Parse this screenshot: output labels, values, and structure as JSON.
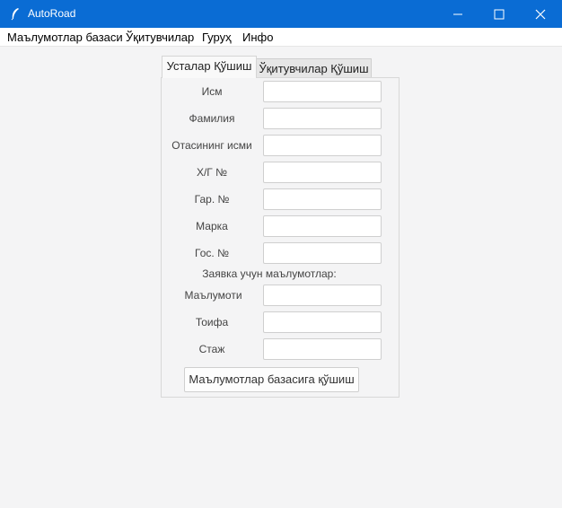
{
  "window": {
    "title": "AutoRoad",
    "controls": [
      "minimize-icon",
      "maximize-icon",
      "close-icon"
    ]
  },
  "menubar": [
    "Маълумотлар базаси",
    "Ўқитувчилар",
    "Гуруҳ",
    "Инфо"
  ],
  "tabs": [
    {
      "label": "Усталар Қўшиш",
      "active": true
    },
    {
      "label": "Ўқитувчилар Қўшиш",
      "active": false
    }
  ],
  "form": {
    "fields": [
      {
        "label": "Исм",
        "value": ""
      },
      {
        "label": "Фамилия",
        "value": ""
      },
      {
        "label": "Отасининг исми",
        "value": ""
      },
      {
        "label": "Х/Г №",
        "value": ""
      },
      {
        "label": "Гар. №",
        "value": ""
      },
      {
        "label": "Марка",
        "value": ""
      },
      {
        "label": "Гос. №",
        "value": ""
      }
    ],
    "section_heading": "Заявка учун маълумотлар:",
    "order_fields": [
      {
        "label": "Маълумоти",
        "value": ""
      },
      {
        "label": "Тоифа",
        "value": ""
      },
      {
        "label": "Стаж",
        "value": ""
      }
    ],
    "submit_label": "Маълумотлар базасига қўшиш"
  },
  "colors": {
    "titlebar": "#0a6cd4",
    "background": "#f4f4f5"
  }
}
